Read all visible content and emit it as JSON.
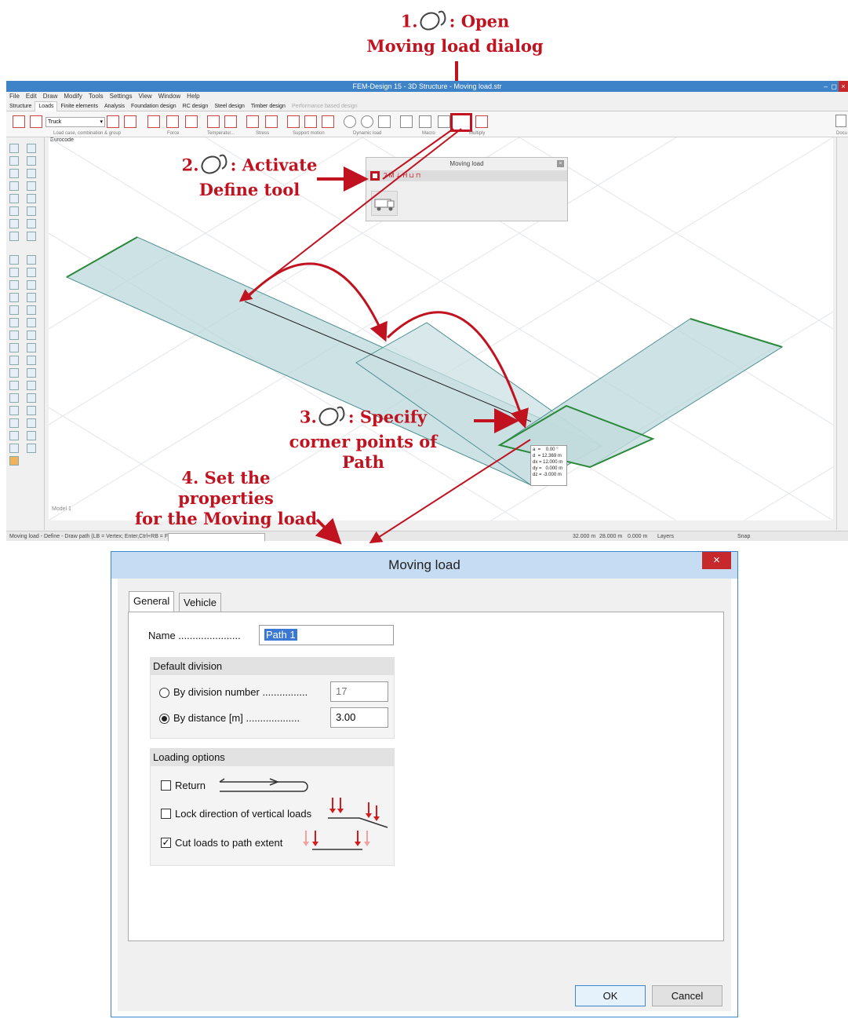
{
  "callouts": {
    "step1_number": "1.",
    "step1_text": ": Open",
    "step1_text2": "Moving load dialog",
    "step2_number": "2.",
    "step2_text": ": Activate",
    "step2_text2": "Define tool",
    "step3_number": "3.",
    "step3_text": ": Specify",
    "step3_text2": "corner points of Path",
    "step4_text": "4. Set the properties",
    "step4_text2": "for the Moving load",
    "color": "#c1121f"
  },
  "app": {
    "title": "FEM-Design 15 - 3D Structure - Moving load.str",
    "menu": [
      "File",
      "Edit",
      "Draw",
      "Modify",
      "Tools",
      "Settings",
      "View",
      "Window",
      "Help"
    ],
    "ribbon_tabs": [
      "Structure",
      "Loads",
      "Finite elements",
      "Analysis",
      "Foundation design",
      "RC design",
      "Steel design",
      "Timber design",
      "Performance based design"
    ],
    "active_tab": "Loads",
    "load_case_value": "Truck",
    "ribbon_groups": [
      "Load case, combination & group",
      "Force",
      "Temperatur...",
      "Stress",
      "Support motion",
      "Dynamic load",
      "Macro",
      "Multiply"
    ],
    "right_panel_label": "Docu",
    "viewport_label": "Eurocode",
    "model_tab": "Model 1",
    "status_prompt": "Moving load - Define - Draw path (LB = Vertex; Enter,Ctrl+RB = Finish) :",
    "status_x": "32.000 m",
    "status_y": "28.000 m",
    "status_z": "0.000 m",
    "status_layers": "Layers",
    "status_snap": "Snap",
    "accent": "#3e82c7"
  },
  "moving_load_panel": {
    "title": "Moving load"
  },
  "coord_box": {
    "a": "a  =    0.00 °",
    "d": "d  = 12.369 m",
    "dx": "dx = 12.000 m",
    "dy": "dy =   0.000 m",
    "dz": "dz = -3.000 m"
  },
  "dialog": {
    "title": "Moving load",
    "close_glyph": "×",
    "tabs": [
      "General",
      "Vehicle"
    ],
    "name_label": "Name ......................",
    "name_value": "Path 1",
    "default_division": {
      "header": "Default division",
      "by_division_number_label": "By division number ................",
      "by_division_number_value": "17",
      "by_distance_label": "By distance [m] ...................",
      "by_distance_value": "3.00",
      "selected": "By distance [m]"
    },
    "loading_options": {
      "header": "Loading options",
      "return_label": "Return",
      "return_checked": false,
      "lock_label": "Lock direction of vertical loads",
      "lock_checked": false,
      "cut_label": "Cut loads to path extent",
      "cut_checked": true
    },
    "ok_label": "OK",
    "cancel_label": "Cancel"
  }
}
